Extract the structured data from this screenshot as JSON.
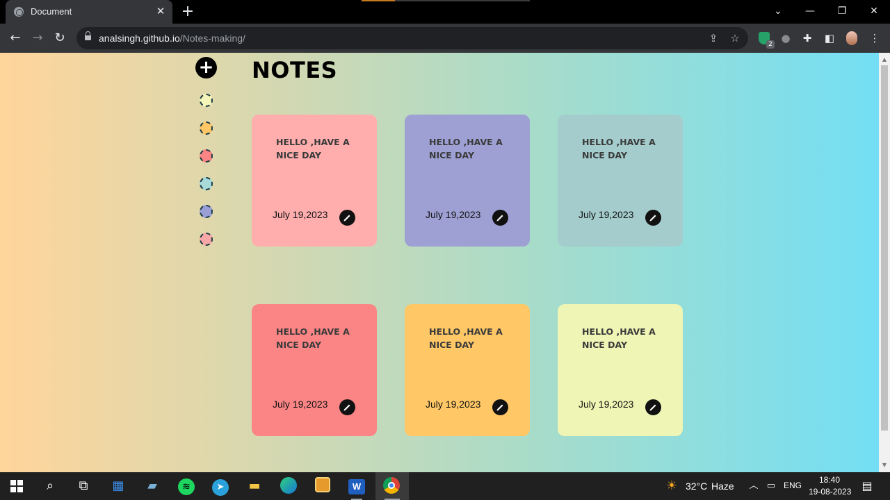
{
  "browser": {
    "tab_title": "Document",
    "url_host": "analsingh.github.io",
    "url_path": "/Notes-making/",
    "extension_badge": "2"
  },
  "page": {
    "title": "NOTES",
    "add_label": "+",
    "color_dots": [
      "#f4f5b8",
      "#ffc766",
      "#fb8585",
      "#a9dada",
      "#9aa0d6",
      "#f6a8a8"
    ],
    "notes": [
      {
        "text": "HELLO ,HAVE A NICE DAY",
        "date": "July 19,2023",
        "color": "#ffadad"
      },
      {
        "text": "HELLO ,HAVE A NICE DAY",
        "date": "July 19,2023",
        "color": "#9ea0d4"
      },
      {
        "text": "HELLO ,HAVE A NICE DAY",
        "date": "July 19,2023",
        "color": "#a4cccc"
      },
      {
        "text": "HELLO ,HAVE A NICE DAY",
        "date": "July 19,2023",
        "color": "#fb8585"
      },
      {
        "text": "HELLO ,HAVE A NICE DAY",
        "date": "July 19,2023",
        "color": "#ffc766"
      },
      {
        "text": "HELLO ,HAVE A NICE DAY",
        "date": "July 19,2023",
        "color": "#eff5b5"
      }
    ]
  },
  "taskbar": {
    "weather_temp": "32°C",
    "weather_desc": "Haze",
    "language": "ENG",
    "time": "18:40",
    "date": "19-08-2023"
  }
}
